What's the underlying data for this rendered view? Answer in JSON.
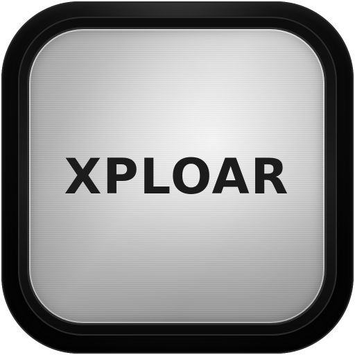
{
  "app_icon": {
    "wordmark": "XPLOAR",
    "colors": {
      "frame": "#0a0a0a",
      "plate_light": "#f4f4f4",
      "plate_dark": "#8f8f8f",
      "text": "#1c1c1c"
    }
  }
}
